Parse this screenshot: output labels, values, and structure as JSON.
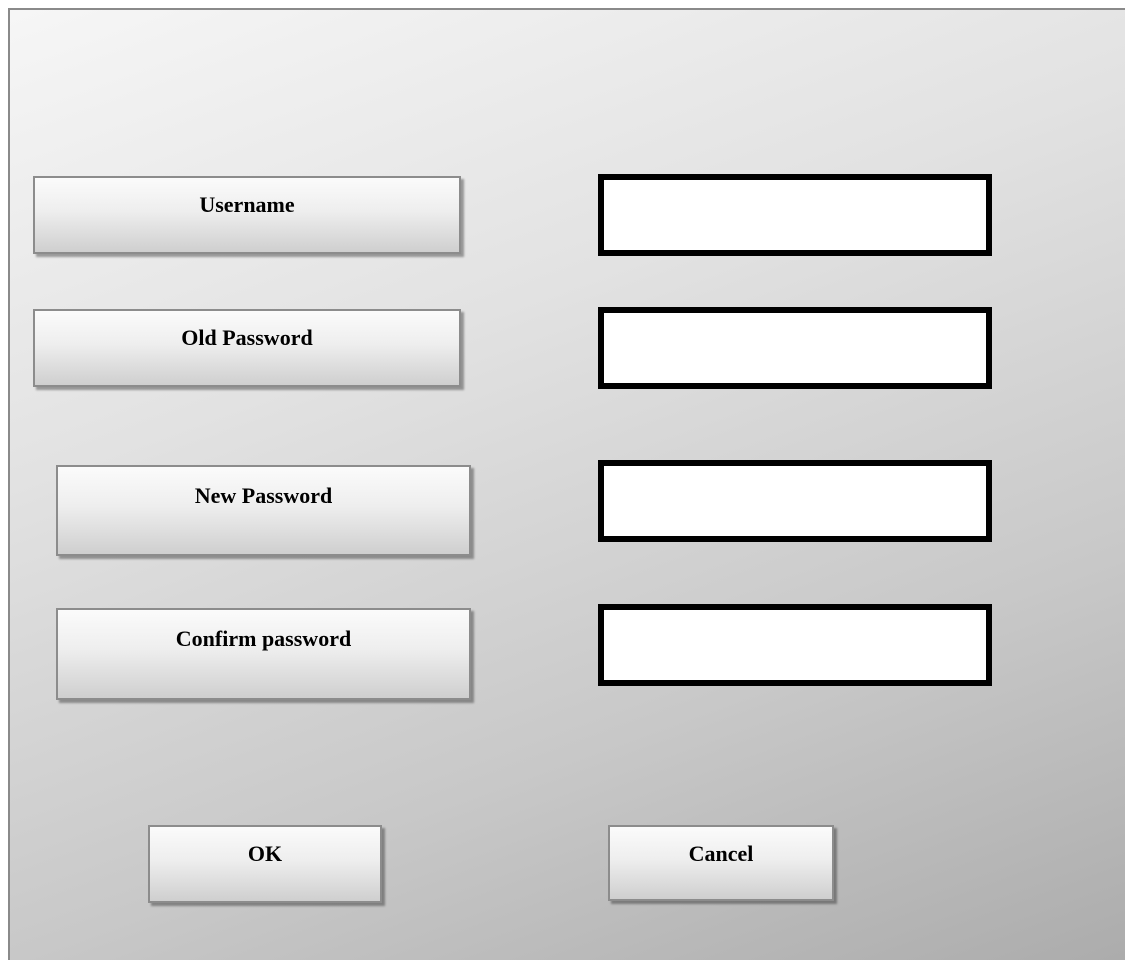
{
  "form": {
    "fields": [
      {
        "label": "Username",
        "value": "",
        "placeholder": ""
      },
      {
        "label": "Old Password",
        "value": "",
        "placeholder": ""
      },
      {
        "label": "New Password",
        "value": "",
        "placeholder": ""
      },
      {
        "label": "Confirm password",
        "value": "",
        "placeholder": ""
      }
    ]
  },
  "actions": {
    "ok_label": "OK",
    "cancel_label": "Cancel"
  }
}
